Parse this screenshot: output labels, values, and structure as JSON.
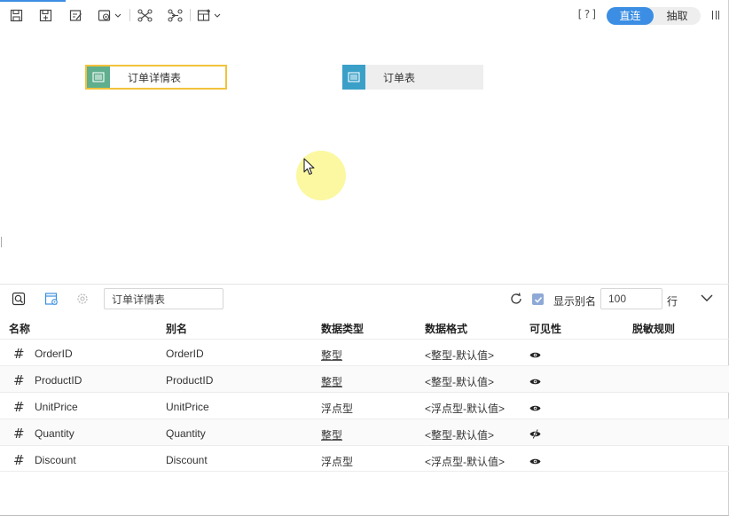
{
  "toolbar": {
    "icons": [
      "save-icon",
      "save-as-icon",
      "edit-icon",
      "settings-dropdown-icon",
      "relation-icon",
      "relation-alt-icon",
      "add-table-dropdown-icon"
    ],
    "help_label": "[?]",
    "mode_direct": "直连",
    "mode_extract": "抽取"
  },
  "canvas": {
    "tables": [
      {
        "name": "订单详情表",
        "selected": true,
        "icon_color": "#5fae8e"
      },
      {
        "name": "订单表",
        "selected": false,
        "icon_color": "#3aa0c8"
      }
    ]
  },
  "panel": {
    "table_name": "订单详情表",
    "show_alias_label": "显示别名",
    "show_alias_checked": true,
    "row_count": "100",
    "row_unit": "行",
    "columns": {
      "name": "名称",
      "alias": "别名",
      "type": "数据类型",
      "format": "数据格式",
      "visibility": "可见性",
      "masking": "脱敏规则"
    },
    "fields": [
      {
        "name": "OrderID",
        "alias": "OrderID",
        "type": "整型",
        "type_underlined": true,
        "format": "<整型-默认值>",
        "visibility_icon": "eye-icon"
      },
      {
        "name": "ProductID",
        "alias": "ProductID",
        "type": "整型",
        "type_underlined": true,
        "format": "<整型-默认值>",
        "visibility_icon": "eye-icon"
      },
      {
        "name": "UnitPrice",
        "alias": "UnitPrice",
        "type": "浮点型",
        "type_underlined": false,
        "format": "<浮点型-默认值>",
        "visibility_icon": "eye-icon"
      },
      {
        "name": "Quantity",
        "alias": "Quantity",
        "type": "整型",
        "type_underlined": true,
        "format": "<整型-默认值>",
        "visibility_icon": "eye-slash-icon"
      },
      {
        "name": "Discount",
        "alias": "Discount",
        "type": "浮点型",
        "type_underlined": false,
        "format": "<浮点型-默认值>",
        "visibility_icon": "eye-icon"
      }
    ]
  },
  "colors": {
    "accent": "#3b8ee3",
    "selected_border": "#f2c23c"
  }
}
